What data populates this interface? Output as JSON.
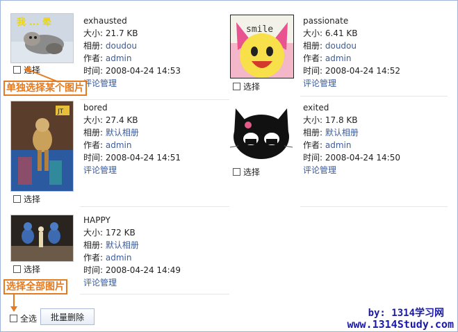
{
  "items": [
    {
      "name": "exhausted",
      "size": "大小: 21.7 KB",
      "album_label": "相册: ",
      "album": "doudou",
      "author_label": "作者: ",
      "author": "admin",
      "time": "时间: 2008-04-24 14:53",
      "manage": "评论管理",
      "select": "选择"
    },
    {
      "name": "passionate",
      "size": "大小: 6.41 KB",
      "album_label": "相册: ",
      "album": "doudou",
      "author_label": "作者: ",
      "author": "admin",
      "time": "时间: 2008-04-24 14:52",
      "manage": "评论管理",
      "select": "选择"
    },
    {
      "name": "bored",
      "size": "大小: 27.4 KB",
      "album_label": "相册: ",
      "album": "默认相册",
      "author_label": "作者: ",
      "author": "admin",
      "time": "时间: 2008-04-24 14:51",
      "manage": "评论管理",
      "select": "选择"
    },
    {
      "name": "exited",
      "size": "大小: 17.8 KB",
      "album_label": "相册: ",
      "album": "默认相册",
      "author_label": "作者: ",
      "author": "admin",
      "time": "时间: 2008-04-24 14:50",
      "manage": "评论管理",
      "select": "选择"
    },
    {
      "name": "HAPPY",
      "size": "大小: 172 KB",
      "album_label": "相册: ",
      "album": "默认相册",
      "author_label": "作者: ",
      "author": "admin",
      "time": "时间: 2008-04-24 14:49",
      "manage": "评论管理",
      "select": "选择"
    }
  ],
  "thumb_text": {
    "exhausted_sign": "我 ... 晕",
    "smile": "smile",
    "bored_tag": "JT"
  },
  "callouts": {
    "single": "单独选择某个图片",
    "all": "选择全部图片"
  },
  "footer": {
    "select_all": "全选",
    "batch_delete": "批量删除"
  },
  "watermark": {
    "line1": "by: 1314学习网",
    "line2": "www.1314Study.com"
  },
  "colors": {
    "accent": "#e67a1e",
    "link": "#3b5b9a",
    "border": "#9fb2d9",
    "watermark": "#1a1aa8"
  }
}
